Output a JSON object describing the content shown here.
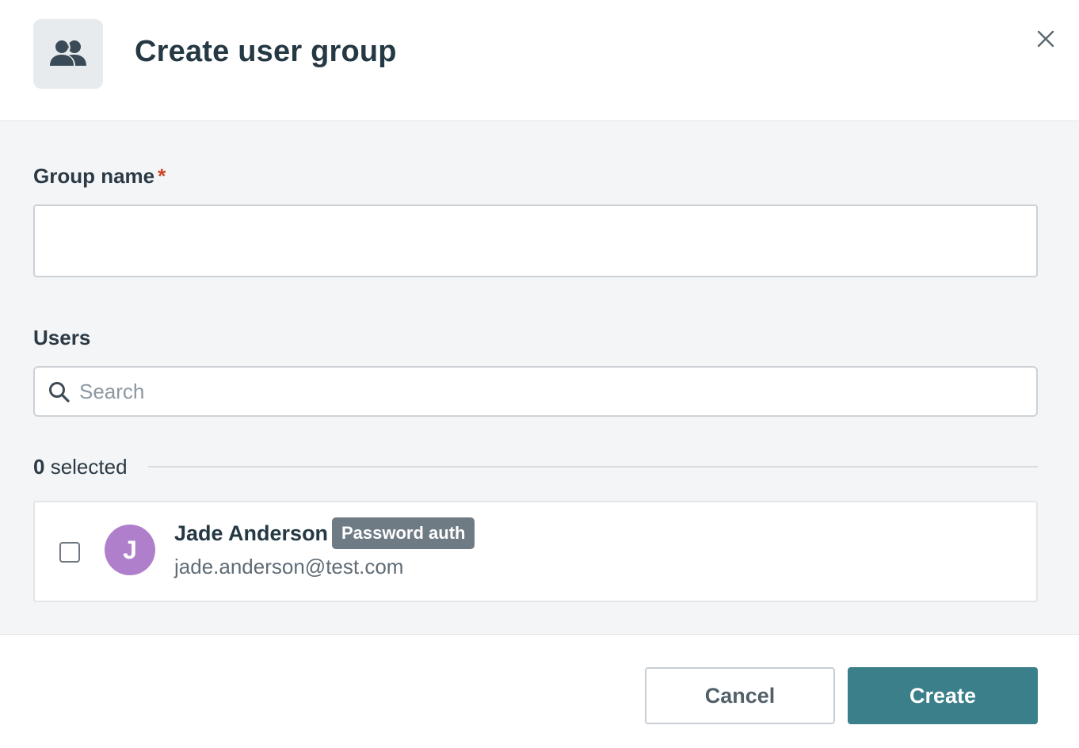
{
  "dialog": {
    "title": "Create user group",
    "header_icon": "users-icon",
    "close_icon": "close-icon"
  },
  "form": {
    "group_name_label": "Group name",
    "required_marker": "*",
    "group_name_value": "",
    "users_label": "Users",
    "search_placeholder": "Search",
    "search_value": "",
    "selected_count": "0",
    "selected_suffix": " selected"
  },
  "users": [
    {
      "initial": "J",
      "name": "Jade Anderson",
      "badge": "Password auth",
      "email": "jade.anderson@test.com",
      "checked": false,
      "avatar_color": "#b07fcc"
    }
  ],
  "footer": {
    "cancel_label": "Cancel",
    "create_label": "Create"
  },
  "colors": {
    "primary": "#3b7f8a",
    "required": "#d0442c",
    "badge": "#6e7a84"
  }
}
